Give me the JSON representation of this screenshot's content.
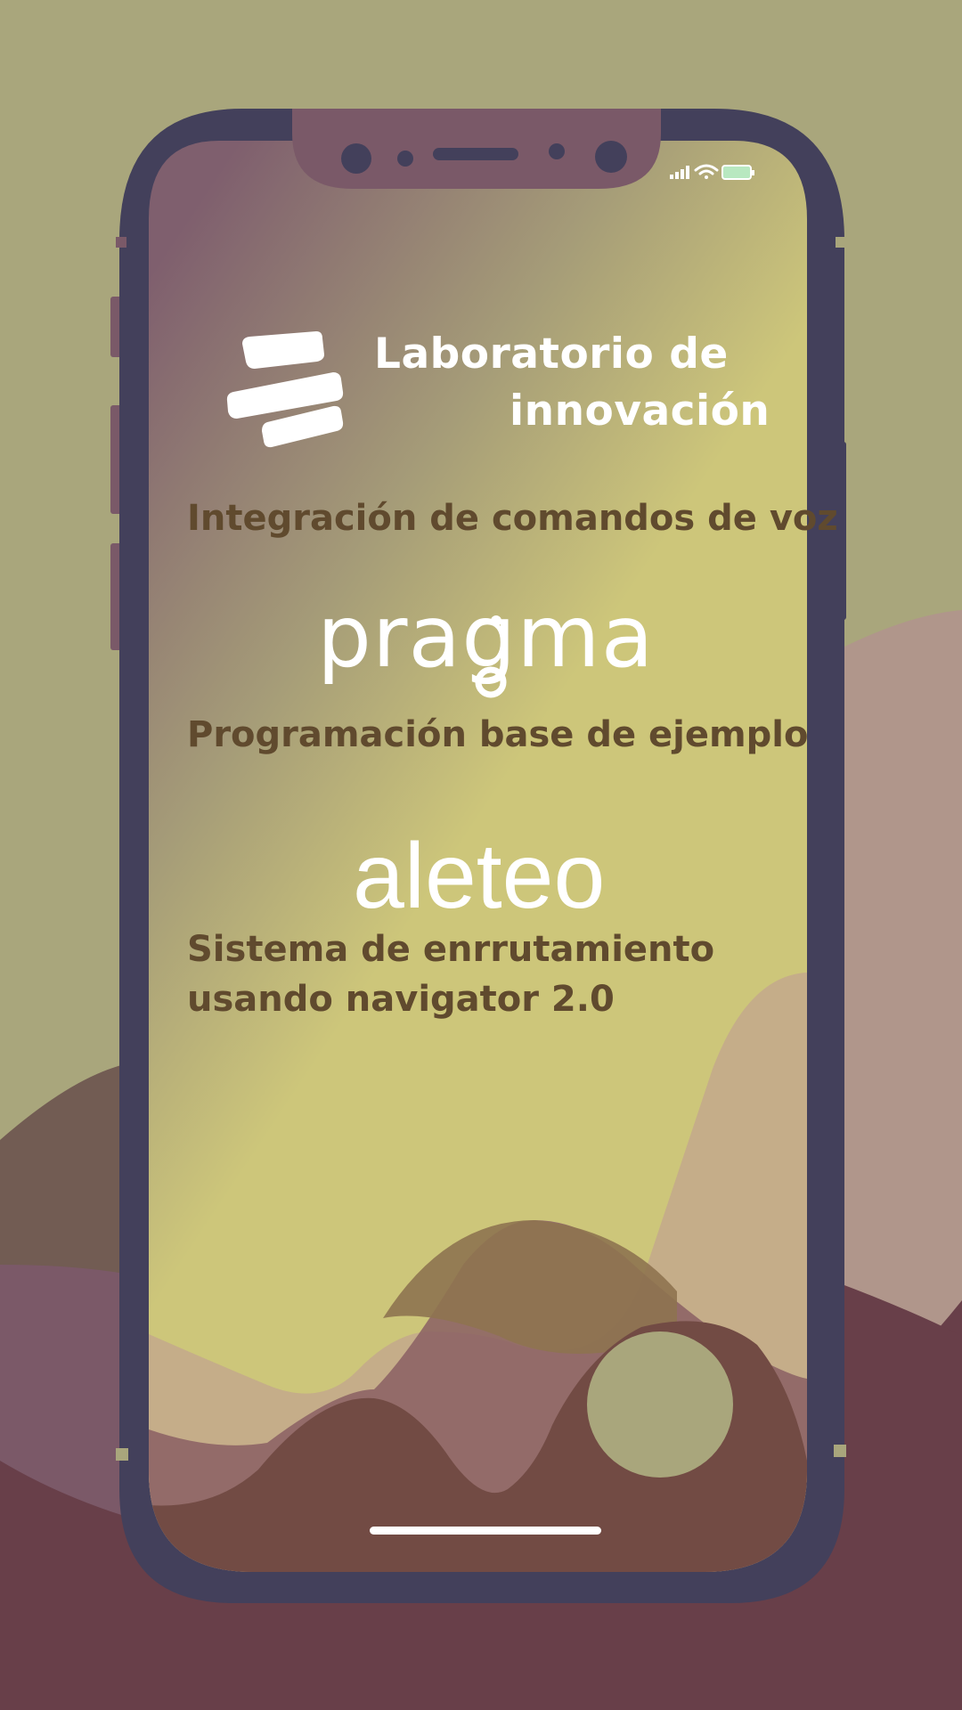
{
  "status_bar": {
    "signal_icon": "signal-bars-icon",
    "wifi_icon": "wifi-icon",
    "battery_icon": "battery-icon"
  },
  "header": {
    "logo_icon": "lab-stripes-logo-icon",
    "title_line1": "Laboratorio de",
    "title_line2": "innovación"
  },
  "sections": [
    {
      "label": "Integración de comandos de voz"
    },
    {
      "brand": "pragma",
      "label": "Programación base de ejemplo"
    },
    {
      "brand": "aleteo",
      "label_line1": "Sistema de enrrutamiento",
      "label_line2": "usando navigator 2.0"
    }
  ],
  "colors": {
    "background": "#a9a67c",
    "phone_frame": "#43405b",
    "text_dark": "#604a2e",
    "text_light": "#ffffff",
    "battery": "#b8e8c0"
  }
}
